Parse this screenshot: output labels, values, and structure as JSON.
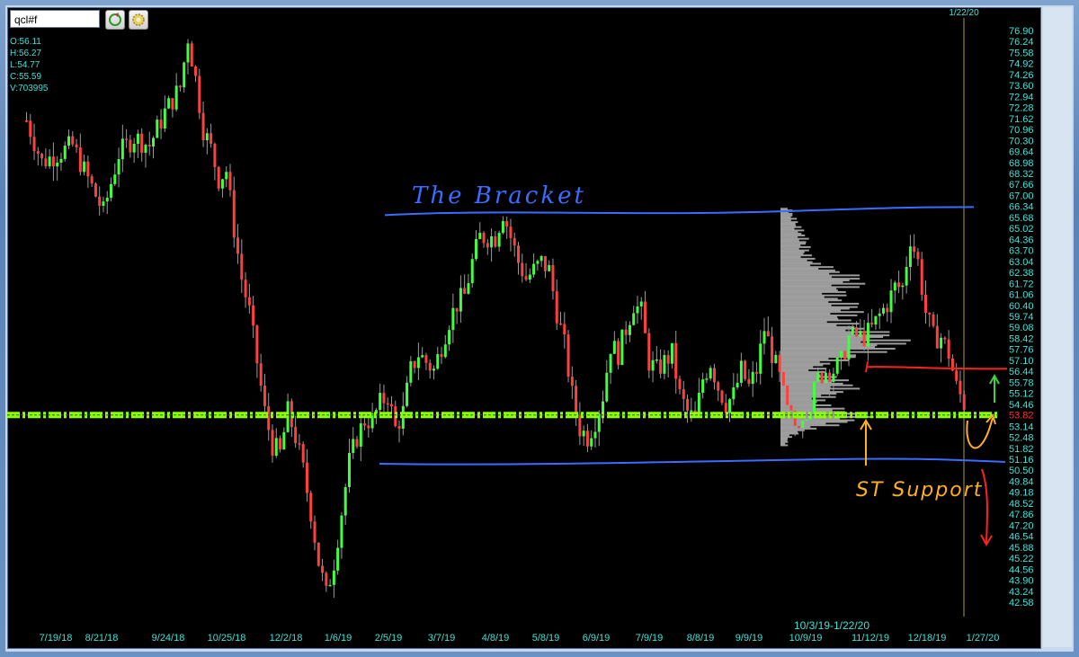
{
  "toolbar": {
    "symbol": "qcl#f",
    "refresh_icon": "refresh-icon",
    "settings_icon": "gear-icon"
  },
  "ohlc": {
    "open": "O:56.11",
    "high": "H:56.27",
    "low": "L:54.77",
    "close": "C:55.59",
    "volume": "V:703995"
  },
  "colors": {
    "background": "#000000",
    "axis_text": "#40e0d8",
    "current_price": "#ff3030",
    "up_candle": "#40ff40",
    "down_candle": "#ff4040",
    "bracket_line": "#3a6cff",
    "support_line": "#8cff00",
    "resistance_line": "#ff2020",
    "annotation_orange": "#ffb020",
    "profile": "#c8c8c8",
    "vline": "#6a6a20"
  },
  "chart_data": {
    "type": "candlestick",
    "symbol": "qcl#f",
    "current_price": "53.82",
    "vline_label": "1/22/20",
    "profile_label": "10/3/19-1/22/20",
    "y_tick_labels": [
      "76.90",
      "76.24",
      "75.58",
      "74.92",
      "74.26",
      "73.60",
      "72.94",
      "72.28",
      "71.62",
      "70.96",
      "70.30",
      "69.64",
      "68.98",
      "68.32",
      "67.66",
      "67.00",
      "66.34",
      "65.68",
      "65.02",
      "64.36",
      "63.70",
      "63.04",
      "62.38",
      "61.72",
      "61.06",
      "60.40",
      "59.74",
      "59.08",
      "58.42",
      "57.76",
      "57.10",
      "56.44",
      "55.78",
      "55.12",
      "54.46",
      "53.82",
      "53.14",
      "52.48",
      "51.82",
      "51.16",
      "50.50",
      "49.84",
      "49.18",
      "48.52",
      "47.86",
      "47.20",
      "46.54",
      "45.88",
      "45.22",
      "44.56",
      "43.90",
      "43.24",
      "42.58"
    ],
    "x_tick_labels": [
      "7/19/18",
      "8/21/18",
      "9/24/18",
      "10/25/18",
      "12/2/18",
      "1/6/19",
      "2/5/19",
      "3/7/19",
      "4/8/19",
      "5/8/19",
      "6/9/19",
      "7/9/19",
      "8/8/19",
      "9/9/19",
      "10/9/19",
      "11/12/19",
      "12/18/19",
      "1/27/20"
    ],
    "price_path": [
      [
        0,
        71.5
      ],
      [
        4,
        69
      ],
      [
        8,
        69.5
      ],
      [
        12,
        70
      ],
      [
        16,
        68
      ],
      [
        20,
        66
      ],
      [
        24,
        69.5
      ],
      [
        28,
        70.5
      ],
      [
        32,
        70
      ],
      [
        36,
        72
      ],
      [
        40,
        73.5
      ],
      [
        42,
        76.5
      ],
      [
        44,
        74
      ],
      [
        46,
        71
      ],
      [
        48,
        69.8
      ],
      [
        50,
        68
      ],
      [
        52,
        68.5
      ],
      [
        54,
        65
      ],
      [
        56,
        62
      ],
      [
        58,
        60
      ],
      [
        60,
        57
      ],
      [
        62,
        54
      ],
      [
        64,
        52
      ],
      [
        66,
        51.5
      ],
      [
        68,
        54
      ],
      [
        70,
        52.5
      ],
      [
        72,
        50.5
      ],
      [
        74,
        48
      ],
      [
        76,
        45
      ],
      [
        78,
        43
      ],
      [
        80,
        45
      ],
      [
        82,
        48
      ],
      [
        84,
        51
      ],
      [
        86,
        52.5
      ],
      [
        88,
        53.5
      ],
      [
        90,
        53.5
      ],
      [
        92,
        54.5
      ],
      [
        94,
        55
      ],
      [
        96,
        53
      ],
      [
        98,
        54
      ],
      [
        100,
        56.5
      ],
      [
        102,
        57.5
      ],
      [
        104,
        57
      ],
      [
        106,
        56.5
      ],
      [
        108,
        58
      ],
      [
        110,
        59.5
      ],
      [
        112,
        60.5
      ],
      [
        114,
        61
      ],
      [
        116,
        63
      ],
      [
        118,
        64.5
      ],
      [
        120,
        64.5
      ],
      [
        122,
        64.5
      ],
      [
        124,
        66
      ],
      [
        126,
        64.5
      ],
      [
        128,
        63
      ],
      [
        130,
        62
      ],
      [
        132,
        62.5
      ],
      [
        134,
        63
      ],
      [
        136,
        62.5
      ],
      [
        138,
        60
      ],
      [
        140,
        58
      ],
      [
        142,
        55
      ],
      [
        144,
        53
      ],
      [
        146,
        52.5
      ],
      [
        148,
        53.5
      ],
      [
        150,
        55
      ],
      [
        152,
        58
      ],
      [
        154,
        57.5
      ],
      [
        156,
        59
      ],
      [
        158,
        60.5
      ],
      [
        160,
        60
      ],
      [
        162,
        57
      ],
      [
        164,
        56.5
      ],
      [
        166,
        57
      ],
      [
        168,
        57.5
      ],
      [
        170,
        55
      ],
      [
        172,
        54
      ],
      [
        174,
        53.5
      ],
      [
        176,
        56
      ],
      [
        178,
        57
      ],
      [
        180,
        55.5
      ],
      [
        182,
        54.5
      ],
      [
        184,
        55
      ],
      [
        186,
        56.5
      ],
      [
        188,
        55.5
      ],
      [
        190,
        56.5
      ],
      [
        192,
        59
      ],
      [
        194,
        57.5
      ],
      [
        196,
        56
      ],
      [
        198,
        54
      ],
      [
        200,
        53.2
      ],
      [
        202,
        54
      ],
      [
        204,
        54.5
      ],
      [
        206,
        56
      ],
      [
        208,
        56.5
      ],
      [
        210,
        56.5
      ],
      [
        212,
        57
      ],
      [
        214,
        58.5
      ],
      [
        216,
        58.5
      ],
      [
        218,
        58.5
      ],
      [
        220,
        59
      ],
      [
        222,
        59.8
      ],
      [
        224,
        60.5
      ],
      [
        226,
        61.5
      ],
      [
        228,
        61.5
      ],
      [
        230,
        64.5
      ],
      [
        232,
        63
      ],
      [
        234,
        60
      ],
      [
        236,
        58.5
      ],
      [
        238,
        58.5
      ],
      [
        240,
        57.5
      ],
      [
        242,
        55.5
      ],
      [
        244,
        54.5
      ]
    ],
    "series": [
      {
        "name": "qcl#f",
        "values": "price_path"
      }
    ],
    "ylim": [
      42.3,
      77.1
    ],
    "grid": false,
    "volume_profile_range": [
      52.0,
      66.3
    ],
    "annotations": {
      "bracket_label": "The Bracket",
      "support_label": "ST Support",
      "upper_bracket_price": 66.3,
      "lower_bracket_price": 51.0,
      "support_price": 53.82,
      "resistance_price": 56.6
    }
  }
}
